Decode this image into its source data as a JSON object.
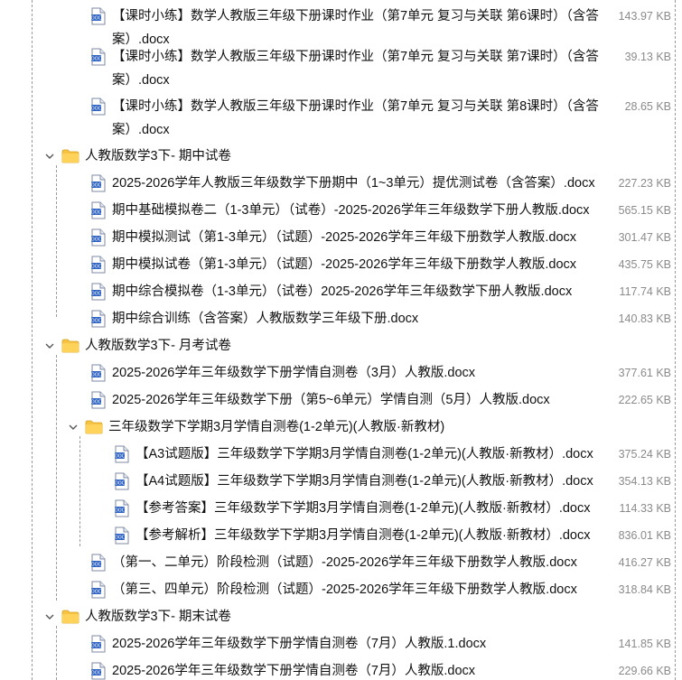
{
  "items": [
    {
      "kind": "file",
      "name": "【课时小练】数学人教版三年级下册课时作业（第7单元 复习与关联 第6课时）（含答案）.docx",
      "size": "143.97 KB"
    },
    {
      "kind": "file",
      "name": "【课时小练】数学人教版三年级下册课时作业（第7单元 复习与关联 第7课时）（含答案）.docx",
      "size": "39.13 KB"
    },
    {
      "kind": "file",
      "name": "【课时小练】数学人教版三年级下册课时作业（第7单元 复习与关联 第8课时）（含答案）.docx",
      "size": "28.65 KB"
    },
    {
      "kind": "folder",
      "name": "人教版数学3下- 期中试卷"
    },
    {
      "kind": "file",
      "name": "2025-2026学年人教版三年级数学下册期中（1~3单元）提优测试卷（含答案）.docx",
      "size": "227.23 KB"
    },
    {
      "kind": "file",
      "name": "期中基础模拟卷二（1-3单元）（试卷）-2025-2026学年三年级数学下册人教版.docx",
      "size": "565.15 KB"
    },
    {
      "kind": "file",
      "name": "期中模拟测试（第1-3单元）（试题）-2025-2026学年三年级下册数学人教版.docx",
      "size": "301.47 KB"
    },
    {
      "kind": "file",
      "name": "期中模拟试卷（第1-3单元）（试题）-2025-2026学年三年级下册数学人教版.docx",
      "size": "435.75 KB"
    },
    {
      "kind": "file",
      "name": "期中综合模拟卷（1-3单元）（试卷）2025-2026学年三年级数学下册人教版.docx",
      "size": "117.74 KB"
    },
    {
      "kind": "file",
      "name": "期中综合训练（含答案）人教版数学三年级下册.docx",
      "size": "140.83 KB"
    },
    {
      "kind": "folder",
      "name": "人教版数学3下- 月考试卷"
    },
    {
      "kind": "file",
      "name": "2025-2026学年三年级数学下册学情自测卷（3月）人教版.docx",
      "size": "377.61 KB"
    },
    {
      "kind": "file",
      "name": "2025-2026学年三年级数学下册（第5~6单元）学情自测（5月）人教版.docx",
      "size": "222.65 KB"
    },
    {
      "kind": "folder",
      "name": "三年级数学下学期3月学情自测卷(1-2单元)(人教版·新教材)"
    },
    {
      "kind": "file",
      "name": "【A3试题版】三年级数学下学期3月学情自测卷(1-2单元)(人教版·新教材）.docx",
      "size": "375.24 KB"
    },
    {
      "kind": "file",
      "name": "【A4试题版】三年级数学下学期3月学情自测卷(1-2单元)(人教版·新教材）.docx",
      "size": "354.13 KB"
    },
    {
      "kind": "file",
      "name": "【参考答案】三年级数学下学期3月学情自测卷(1-2单元)(人教版·新教材）.docx",
      "size": "114.33 KB"
    },
    {
      "kind": "file",
      "name": "【参考解析】三年级数学下学期3月学情自测卷(1-2单元)(人教版·新教材）.docx",
      "size": "836.01 KB"
    },
    {
      "kind": "file",
      "name": "（第一、二单元）阶段检测（试题）-2025-2026学年三年级下册数学人教版.docx",
      "size": "416.27 KB"
    },
    {
      "kind": "file",
      "name": "（第三、四单元）阶段检测（试题）-2025-2026学年三年级下册数学人教版.docx",
      "size": "318.84 KB"
    },
    {
      "kind": "folder",
      "name": "人教版数学3下- 期末试卷"
    },
    {
      "kind": "file",
      "name": "2025-2026学年三年级数学下册学情自测卷（7月）人教版.1.docx",
      "size": "141.85 KB"
    },
    {
      "kind": "file",
      "name": "2025-2026学年三年级数学下册学情自测卷（7月）人教版.docx",
      "size": "229.66 KB"
    }
  ]
}
